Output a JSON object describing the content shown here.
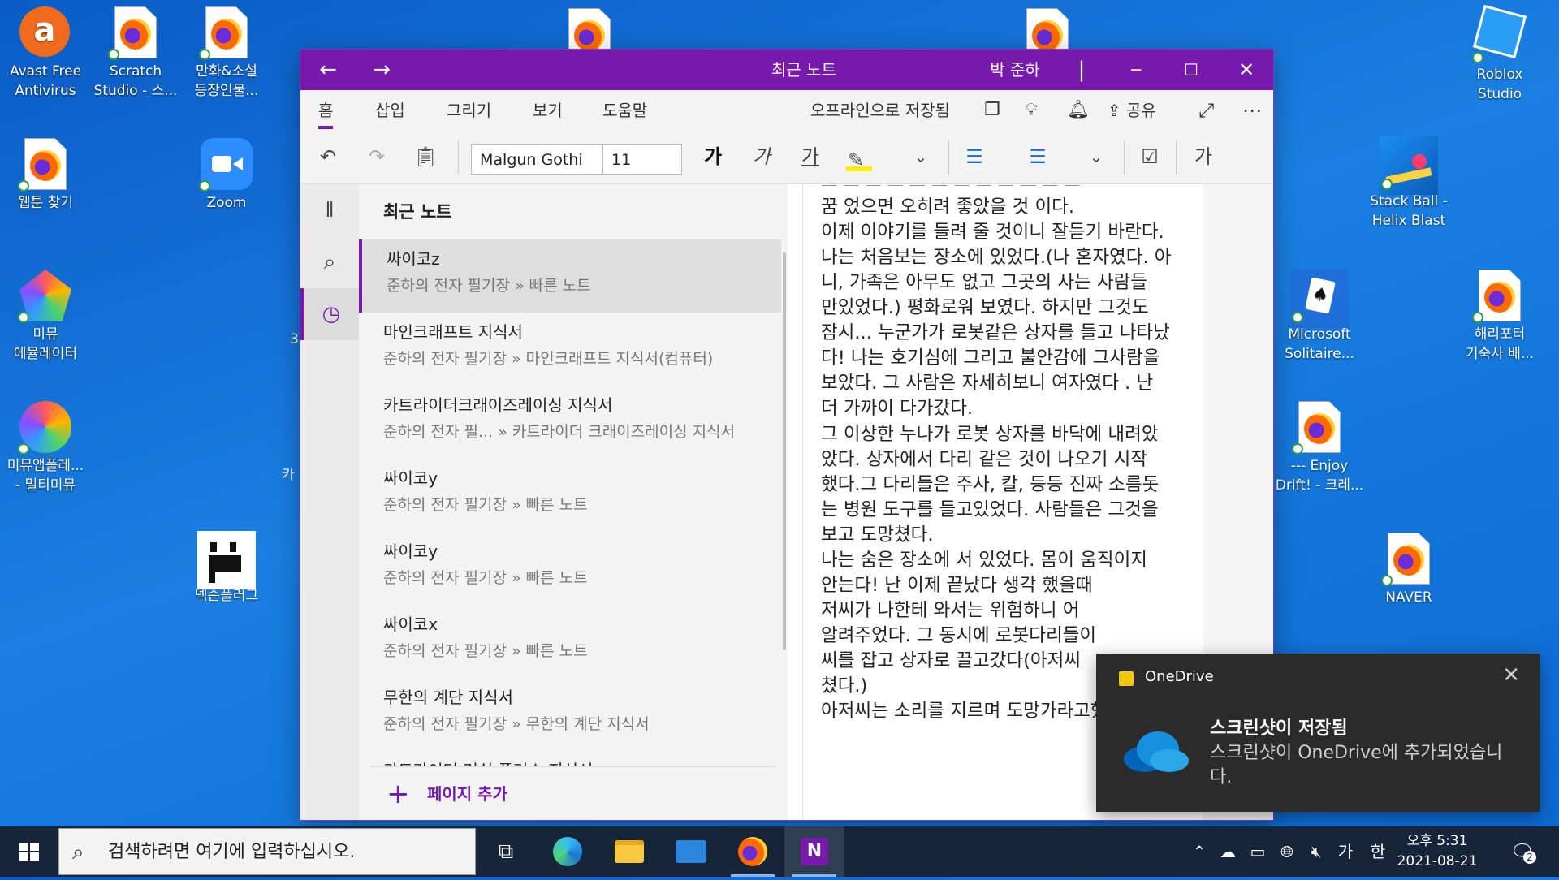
{
  "desktop": {
    "icons_left": [
      {
        "label": "Avast Free\nAntivirus"
      },
      {
        "label": "Scratch\nStudio - 스..."
      },
      {
        "label": "만화&소설\n등장인물..."
      },
      {
        "label": "웹툰 찾기"
      },
      {
        "label": "Zoom"
      },
      {
        "label": "미뮤\n에뮬레이터"
      },
      {
        "label": "미뮤앱플레...\n- 멀티미뮤"
      },
      {
        "label": "넥슨플러그"
      }
    ],
    "icons_right": [
      {
        "label": "Roblox\nStudio"
      },
      {
        "label": "Stack Ball -\nHelix Blast"
      },
      {
        "label": "Microsoft\nSolitaire..."
      },
      {
        "label": "해리포터\n기숙사 배..."
      },
      {
        "label": "--- Enjoy\nDrift! - 크레..."
      },
      {
        "label": "NAVER"
      }
    ],
    "partial_labels": [
      "3",
      "카"
    ]
  },
  "window": {
    "title": "최근 노트",
    "user": "박 준하",
    "menu_tabs": [
      "홈",
      "삽입",
      "그리기",
      "보기",
      "도움말"
    ],
    "status": "오프라인으로 저장됨",
    "share_label": "공유",
    "font_name": "Malgun Gothi",
    "font_size": "11",
    "bold_glyph": "가",
    "italic_glyph": "가",
    "underline_glyph": "가",
    "style_glyph": "가"
  },
  "pagelist": {
    "header": "최근 노트",
    "items": [
      {
        "title": "싸이코z",
        "path": "준하의 전자 필기장 » 빠른 노트"
      },
      {
        "title": "마인크래프트 지식서",
        "path": "준하의 전자 필기장 » 마인크래프트 지식서(컴퓨터)"
      },
      {
        "title": "카트라이더크래이즈레이싱 지식서",
        "path": "준하의 전자 필... » 카트라이더 크래이즈레이싱 지식서"
      },
      {
        "title": "싸이코y",
        "path": "준하의 전자 필기장 » 빠른 노트"
      },
      {
        "title": "싸이코y",
        "path": "준하의 전자 필기장 » 빠른 노트"
      },
      {
        "title": "싸이코x",
        "path": "준하의 전자 필기장 » 빠른 노트"
      },
      {
        "title": "무한의 계단 지식서",
        "path": "준하의 전자 필기장 » 무한의 계단 지식서"
      },
      {
        "title": "카트라이더 러쉬 플러스 지식서",
        "path": ""
      }
    ],
    "add_page": "페이지 추가"
  },
  "content": {
    "lines": [
      "꿈 었으면 오히려 좋았을 것 이다.",
      "이제 이야기를 들려 줄 것이니 잘듣기 바란다.",
      "나는 처음보는 장소에 있었다.(나 혼자였다. 아",
      "니, 가족은 아무도 없고 그곳의 사는 사람들",
      "만있었다.) 평화로워 보였다.  하지만 그것도",
      "잠시... 누군가가 로봇같은 상자를 들고 나타났",
      "다! 나는 호기심에 그리고 불안감에  그사람을",
      "보았다. 그 사람은 자세히보니 여자였다 . 난",
      "더 가까이 다가갔다.",
      "그 이상한 누나가 로봇 상자를 바닥에 내려았",
      "았다. 상자에서 다리 같은 것이 나오기  시작",
      "했다.그 다리들은 주사, 칼, 등등 진짜 소름돗",
      "는 병원 도구를 들고있었다. 사람들은 그것을",
      "보고 도망쳤다.",
      "나는 숨은 장소에 서 있었다. 몸이 움직이지",
      "안는다! 난 이제 끝났다 생각 했을때",
      "저씨가 나한테 와서는 위험하니 어",
      "알려주었다. 그 동시에 로봇다리들이",
      "씨를 잡고 상자로 끌고갔다(아저씨",
      "쳤다.)",
      "아저씨는 소리를 지르며 도망가라고했다 이제"
    ]
  },
  "toast": {
    "app": "OneDrive",
    "title": "스크린샷이 저장됨",
    "body": "스크린샷이 OneDrive에 추가되었습니다."
  },
  "taskbar": {
    "search_placeholder": "검색하려면 여기에 입력하십시오.",
    "ime_mode": "가",
    "ime_lang": "한",
    "time": "오후 5:31",
    "date": "2021-08-21",
    "notification_count": "2"
  },
  "colors": {
    "onenote_purple": "#7719aa",
    "desktop_blue": "#1a7fe0",
    "taskbar": "#17253a",
    "toast_bg": "#2b2b2b"
  }
}
